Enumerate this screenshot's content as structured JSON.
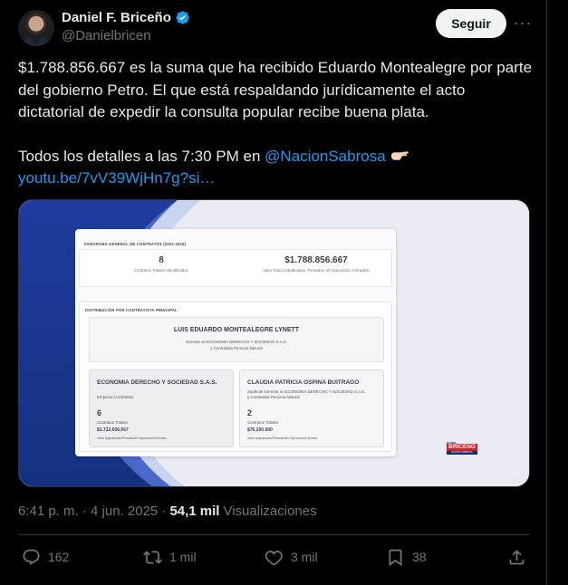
{
  "author": {
    "display_name": "Daniel F. Briceño",
    "handle": "@Danielbricen"
  },
  "follow_label": "Seguir",
  "more_label": "···",
  "tweet": {
    "line1": "$1.788.856.667 es la suma que ha recibido Eduardo Montealegre por parte del gobierno Petro. El que está respaldando jurídicamente el acto dictatorial de expedir la consulta popular recibe buena plata.",
    "line2_prefix": "Todos los detalles a las 7:30 PM en ",
    "mention": "@NacionSabrosa",
    "link": "youtu.be/7vV39WjHn7g?si…"
  },
  "media": {
    "section1_title": "PANORAMA GENERAL DE CONTRATOS (2022-2025)",
    "kpi1_value": "8",
    "kpi1_label": "Contratos Totales Identificados",
    "kpi2_value": "$1.788.856.667",
    "kpi2_label": "Valor Total (Adjudicados, Firmados, En Ejecución, Cerrados)",
    "section2_title": "DISTRIBUCIÓN POR CONTRATISTA PRINCIPAL",
    "main_name": "LUIS EDUARDO MONTEALEGRE LYNETT",
    "main_sub1": "Gerente de ECONOMIA DERECHO Y SOCIEDAD S.A.S.",
    "main_sub2": "y Contratista Persona Natural",
    "left": {
      "title": "ECONOMIA DERECHO Y SOCIEDAD S.A.S.",
      "role": "Empresa Contratista",
      "count": "6",
      "count_label": "Contratos Totales",
      "amount": "$1.712.656.667",
      "amount_label": "Valor Adjudicado/Firmado/En Ejecución/Cerrado"
    },
    "right": {
      "title": "CLAUDIA PATRICIA OSPINA BUITRAGO",
      "role1": "Suplente Gerente en ECONOMIA DERECHO Y SOCIEDAD S.A.S.",
      "role2": "y Contratista Persona Natural",
      "count": "2",
      "count_label": "Contratos Totales",
      "amount": "$76.200.000",
      "amount_label": "Valor Adjudicado/Firmado/En Ejecución/Cerrado"
    },
    "logo_top": "DANIEL",
    "logo_main": "BRICEÑO",
    "logo_bottom": "NACIÓN SABROSA"
  },
  "meta": {
    "time": "6:41 p. m. · 4 jun. 2025 ·",
    "views_count": "54,1 mil",
    "views_label": "Visualizaciones"
  },
  "actions": {
    "replies": "162",
    "reposts": "1 mil",
    "likes": "3 mil",
    "bookmarks": "38"
  },
  "colors": {
    "background": "#000000",
    "text": "#e7e9ea",
    "muted": "#71767b",
    "link": "#1d9bf0",
    "verified": "#1d9bf0"
  }
}
